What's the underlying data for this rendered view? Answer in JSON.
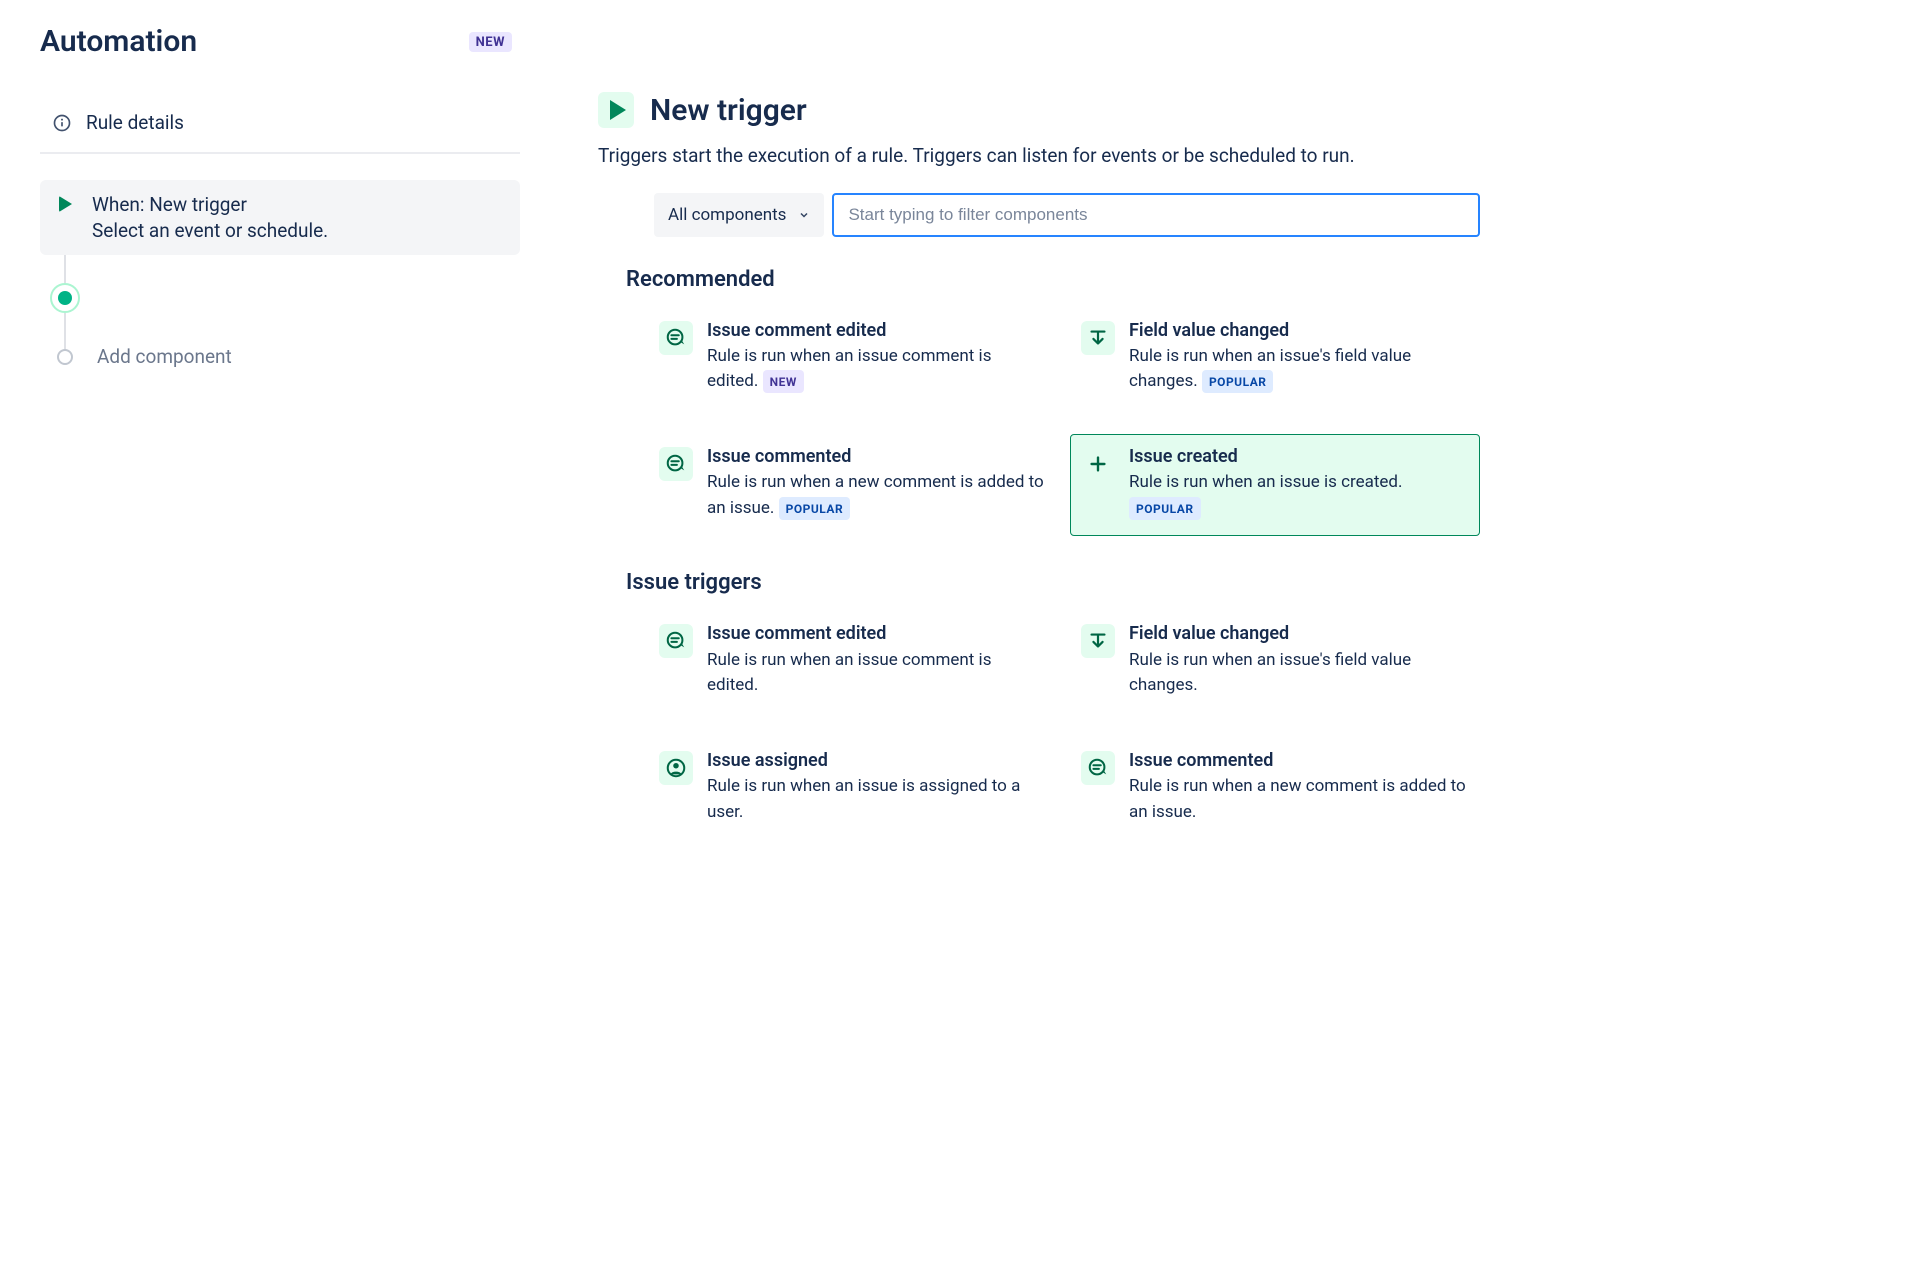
{
  "page_title": "Automation",
  "page_badge": "NEW",
  "sidebar": {
    "rule_details_label": "Rule details",
    "step_when_title": "When: New trigger",
    "step_when_sub": "Select an event or schedule.",
    "add_component_label": "Add component"
  },
  "panel": {
    "title": "New trigger",
    "description": "Triggers start the execution of a rule. Triggers can listen for events or be scheduled to run.",
    "dropdown_label": "All components",
    "search_placeholder": "Start typing to filter components"
  },
  "badges": {
    "new": "NEW",
    "popular": "POPULAR"
  },
  "sections": [
    {
      "heading": "Recommended",
      "cards": [
        {
          "icon": "comment",
          "title": "Issue comment edited",
          "desc": "Rule is run when an issue comment is edited.",
          "badge": "new",
          "selected": false
        },
        {
          "icon": "field",
          "title": "Field value changed",
          "desc": "Rule is run when an issue's field value changes.",
          "badge": "popular",
          "selected": false
        },
        {
          "icon": "comment",
          "title": "Issue commented",
          "desc": "Rule is run when a new comment is added to an issue.",
          "badge": "popular",
          "selected": false
        },
        {
          "icon": "plus",
          "title": "Issue created",
          "desc": "Rule is run when an issue is created.",
          "badge": "popular",
          "selected": true
        }
      ]
    },
    {
      "heading": "Issue triggers",
      "cards": [
        {
          "icon": "comment",
          "title": "Issue comment edited",
          "desc": "Rule is run when an issue comment is edited.",
          "badge": null,
          "selected": false
        },
        {
          "icon": "field",
          "title": "Field value changed",
          "desc": "Rule is run when an issue's field value changes.",
          "badge": null,
          "selected": false
        },
        {
          "icon": "person",
          "title": "Issue assigned",
          "desc": "Rule is run when an issue is assigned to a user.",
          "badge": null,
          "selected": false
        },
        {
          "icon": "comment",
          "title": "Issue commented",
          "desc": "Rule is run when a new comment is added to an issue.",
          "badge": null,
          "selected": false
        }
      ]
    }
  ]
}
